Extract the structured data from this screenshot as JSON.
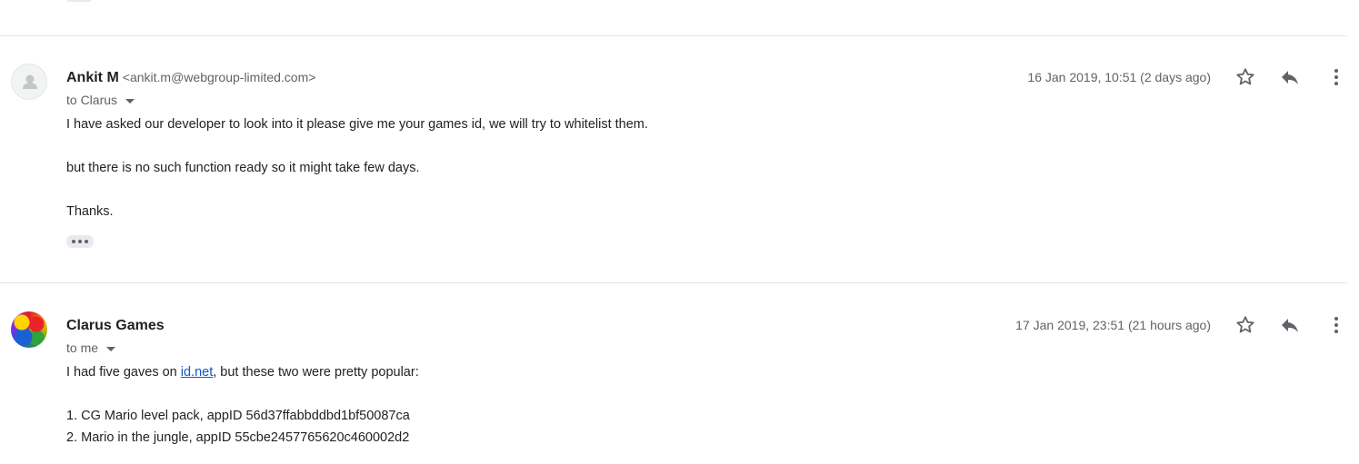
{
  "messages": [
    {
      "sender_name": "Ankit M",
      "sender_email": "<ankit.m@webgroup-limited.com>",
      "to_label": "to Clarus",
      "date": "16 Jan 2019, 10:51 (2 days ago)",
      "avatar": "default-person-icon",
      "body": [
        "I have asked our developer to look into it please give me your games id, we will try to whitelist them.",
        "but there is no such function ready so it might take few days.",
        "Thanks."
      ],
      "show_trimmed": "•••"
    },
    {
      "sender_name": "Clarus Games",
      "sender_email": "",
      "to_label": "to me",
      "date": "17 Jan 2019, 23:51 (21 hours ago)",
      "avatar": "profile-photo",
      "body_intro_before": "I had five gaves on ",
      "body_intro_link": "id.net",
      "body_intro_after": ", but these two were pretty popular:",
      "list": [
        "1. CG Mario level pack, appID 56d37ffabbddbd1bf50087ca",
        "2. Mario in the jungle, appID 55cbe2457765620c460002d2"
      ]
    }
  ],
  "icons": {
    "star": "star-outline-icon",
    "reply": "reply-icon",
    "more": "more-vert-icon",
    "caret": "caret-down-icon"
  },
  "colors": {
    "link": "#1155cc",
    "secondary_text": "#5f6368",
    "divider": "#e5e5e5"
  }
}
